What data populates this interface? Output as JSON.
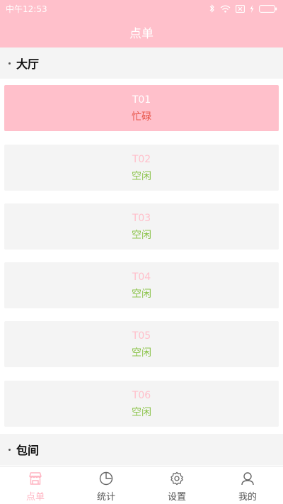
{
  "status_bar": {
    "time": "中午12:53"
  },
  "header": {
    "title": "点单"
  },
  "sections": [
    {
      "label": "大厅"
    },
    {
      "label": "包间"
    }
  ],
  "tables": [
    {
      "name": "T01",
      "status": "忙碌",
      "busy": true
    },
    {
      "name": "T02",
      "status": "空闲",
      "busy": false
    },
    {
      "name": "T03",
      "status": "空闲",
      "busy": false
    },
    {
      "name": "T04",
      "status": "空闲",
      "busy": false
    },
    {
      "name": "T05",
      "status": "空闲",
      "busy": false
    },
    {
      "name": "T06",
      "status": "空闲",
      "busy": false
    }
  ],
  "tab_bar": {
    "items": [
      {
        "label": "点单",
        "icon": "store-icon",
        "active": true
      },
      {
        "label": "统计",
        "icon": "pie-chart-icon",
        "active": false
      },
      {
        "label": "设置",
        "icon": "gear-icon",
        "active": false
      },
      {
        "label": "我的",
        "icon": "user-icon",
        "active": false
      }
    ]
  },
  "colors": {
    "accent": "#ffc0cb",
    "idle": "#8bc34a",
    "busy": "#e8564b"
  }
}
